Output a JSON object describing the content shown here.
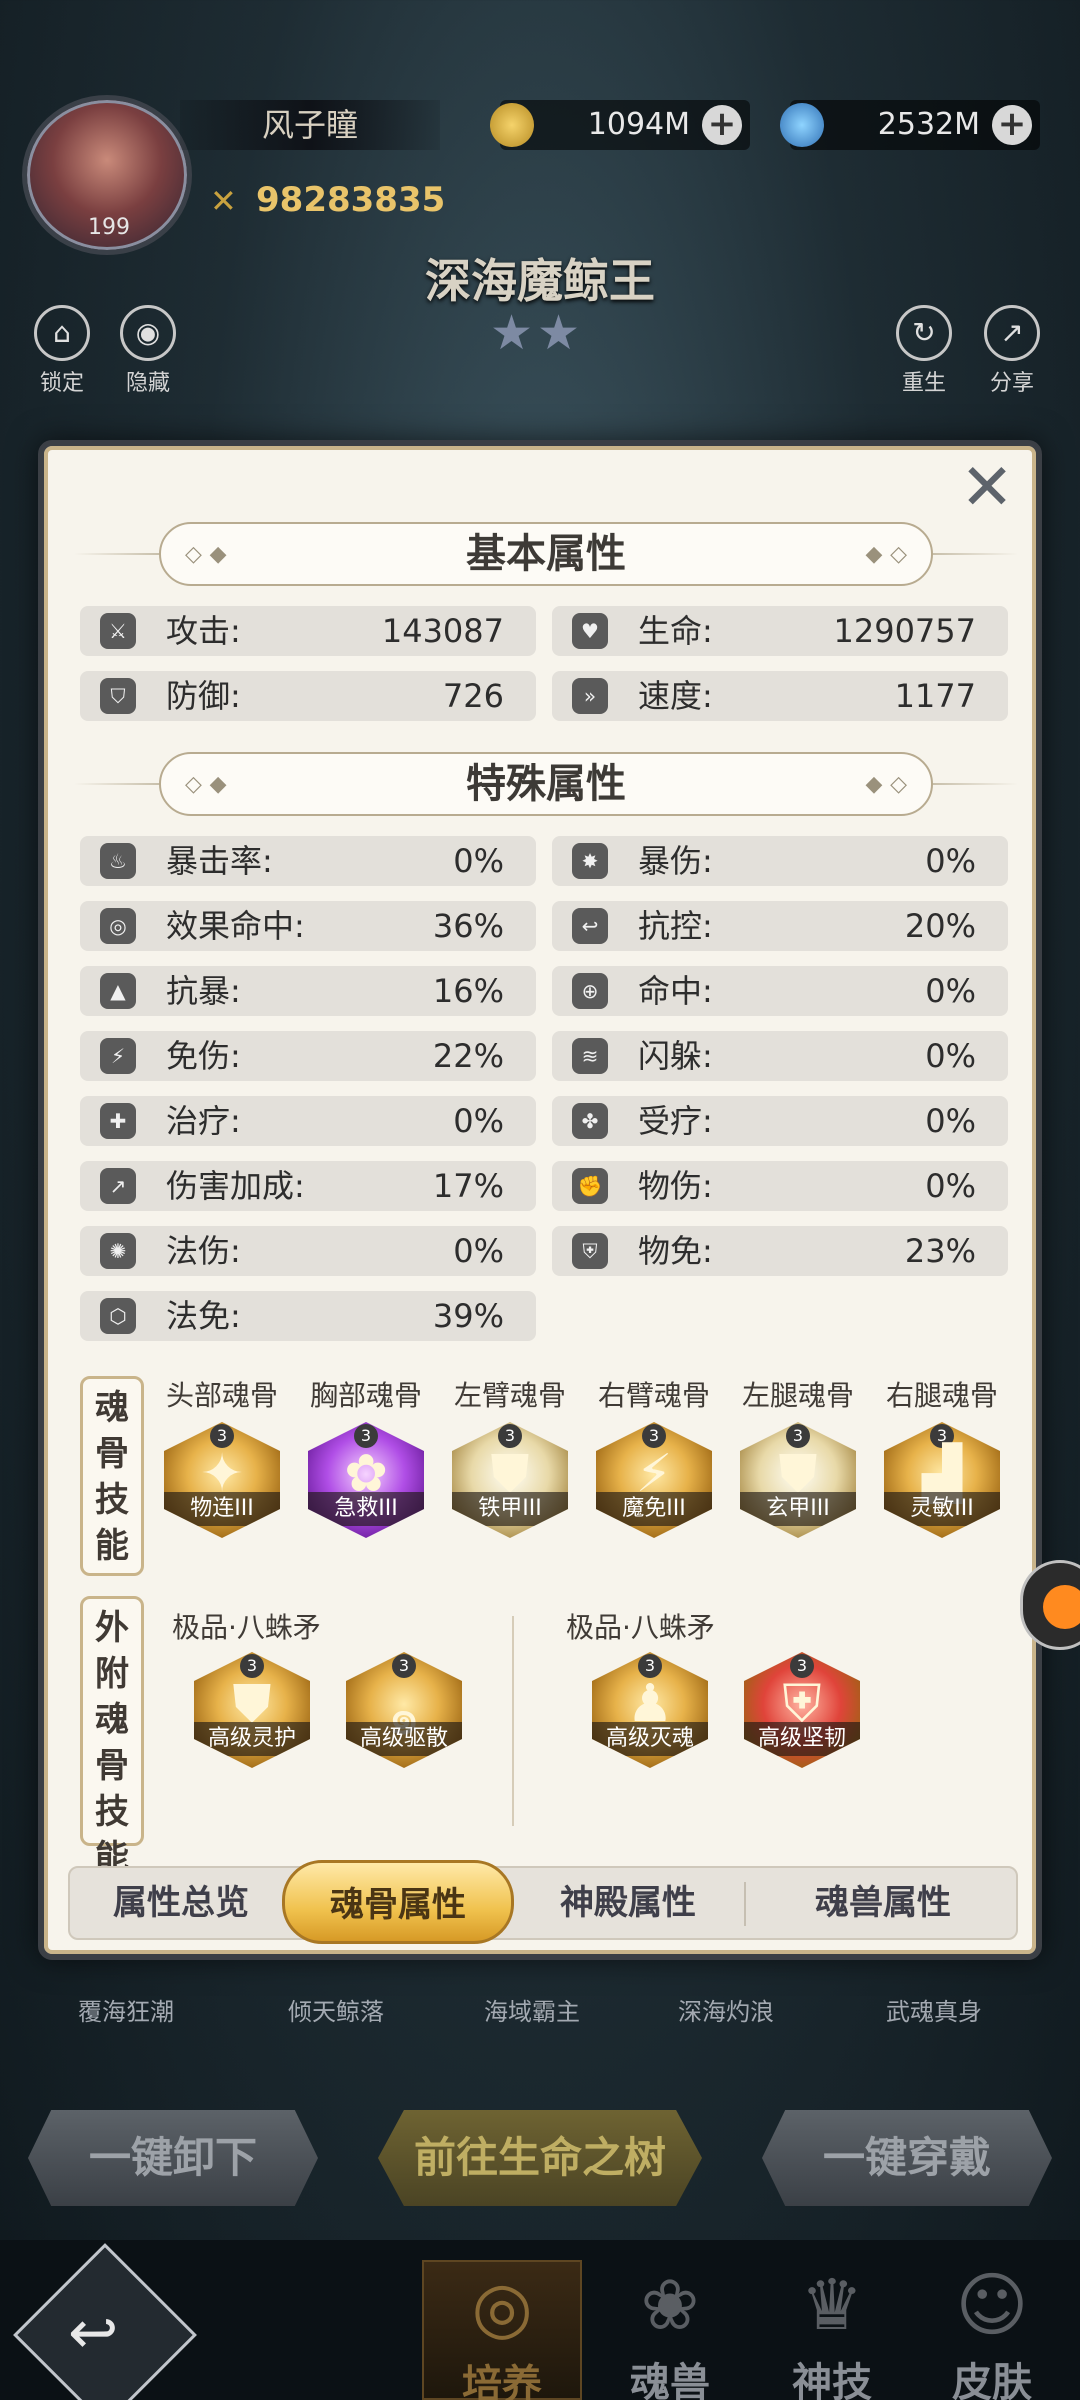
{
  "player": {
    "name": "风子瞳",
    "level": "199",
    "power": "98283835",
    "gold": "1094M",
    "gems": "2532M"
  },
  "boss": {
    "title": "深海魔鲸王",
    "stars": "★★"
  },
  "side_buttons": {
    "lock": "锁定",
    "hide": "隐藏",
    "rebirth": "重生",
    "share": "分享"
  },
  "sections": {
    "basic": "基本属性",
    "special": "特殊属性"
  },
  "basic_stats": [
    {
      "label": "攻击:",
      "value": "143087"
    },
    {
      "label": "生命:",
      "value": "1290757"
    },
    {
      "label": "防御:",
      "value": "726"
    },
    {
      "label": "速度:",
      "value": "1177"
    }
  ],
  "special_stats": [
    {
      "label": "暴击率:",
      "value": "0%"
    },
    {
      "label": "暴伤:",
      "value": "0%"
    },
    {
      "label": "效果命中:",
      "value": "36%"
    },
    {
      "label": "抗控:",
      "value": "20%"
    },
    {
      "label": "抗暴:",
      "value": "16%"
    },
    {
      "label": "命中:",
      "value": "0%"
    },
    {
      "label": "免伤:",
      "value": "22%"
    },
    {
      "label": "闪躲:",
      "value": "0%"
    },
    {
      "label": "治疗:",
      "value": "0%"
    },
    {
      "label": "受疗:",
      "value": "0%"
    },
    {
      "label": "伤害加成:",
      "value": "17%"
    },
    {
      "label": "物伤:",
      "value": "0%"
    },
    {
      "label": "法伤:",
      "value": "0%"
    },
    {
      "label": "物免:",
      "value": "23%"
    },
    {
      "label": "法免:",
      "value": "39%"
    }
  ],
  "soul_bone": {
    "label": "魂骨技能",
    "slots": [
      {
        "title": "头部魂骨",
        "skill": "物连III",
        "level": "3"
      },
      {
        "title": "胸部魂骨",
        "skill": "急救III",
        "level": "3"
      },
      {
        "title": "左臂魂骨",
        "skill": "铁甲III",
        "level": "3"
      },
      {
        "title": "右臂魂骨",
        "skill": "魔免III",
        "level": "3"
      },
      {
        "title": "左腿魂骨",
        "skill": "玄甲III",
        "level": "3"
      },
      {
        "title": "右腿魂骨",
        "skill": "灵敏III",
        "level": "3"
      }
    ]
  },
  "external_bone": {
    "label": "外附魂骨技能",
    "groups": [
      {
        "title": "极品·八蛛矛",
        "skills": [
          {
            "name": "高级灵护",
            "level": "3"
          },
          {
            "name": "高级驱散",
            "level": "3"
          }
        ]
      },
      {
        "title": "极品·八蛛矛",
        "skills": [
          {
            "name": "高级灭魂",
            "level": "3"
          },
          {
            "name": "高级坚韧",
            "level": "3"
          }
        ]
      }
    ]
  },
  "tabs": [
    "属性总览",
    "魂骨属性",
    "神殿属性",
    "魂兽属性"
  ],
  "active_tab": "魂骨属性",
  "behind_strip": [
    "覆海狂潮",
    "倾天鲸落",
    "海域霸主",
    "深海灼浪",
    "武魂真身"
  ],
  "actions": {
    "unequip_all": "一键卸下",
    "tree_of_life": "前往生命之树",
    "equip_all": "一键穿戴"
  },
  "bottom_nav": [
    {
      "label": "培养",
      "icon": "cultivate-icon"
    },
    {
      "label": "魂兽",
      "icon": "paw-icon"
    },
    {
      "label": "神技",
      "icon": "divine-skill-icon"
    },
    {
      "label": "皮肤",
      "icon": "skin-icon"
    }
  ]
}
